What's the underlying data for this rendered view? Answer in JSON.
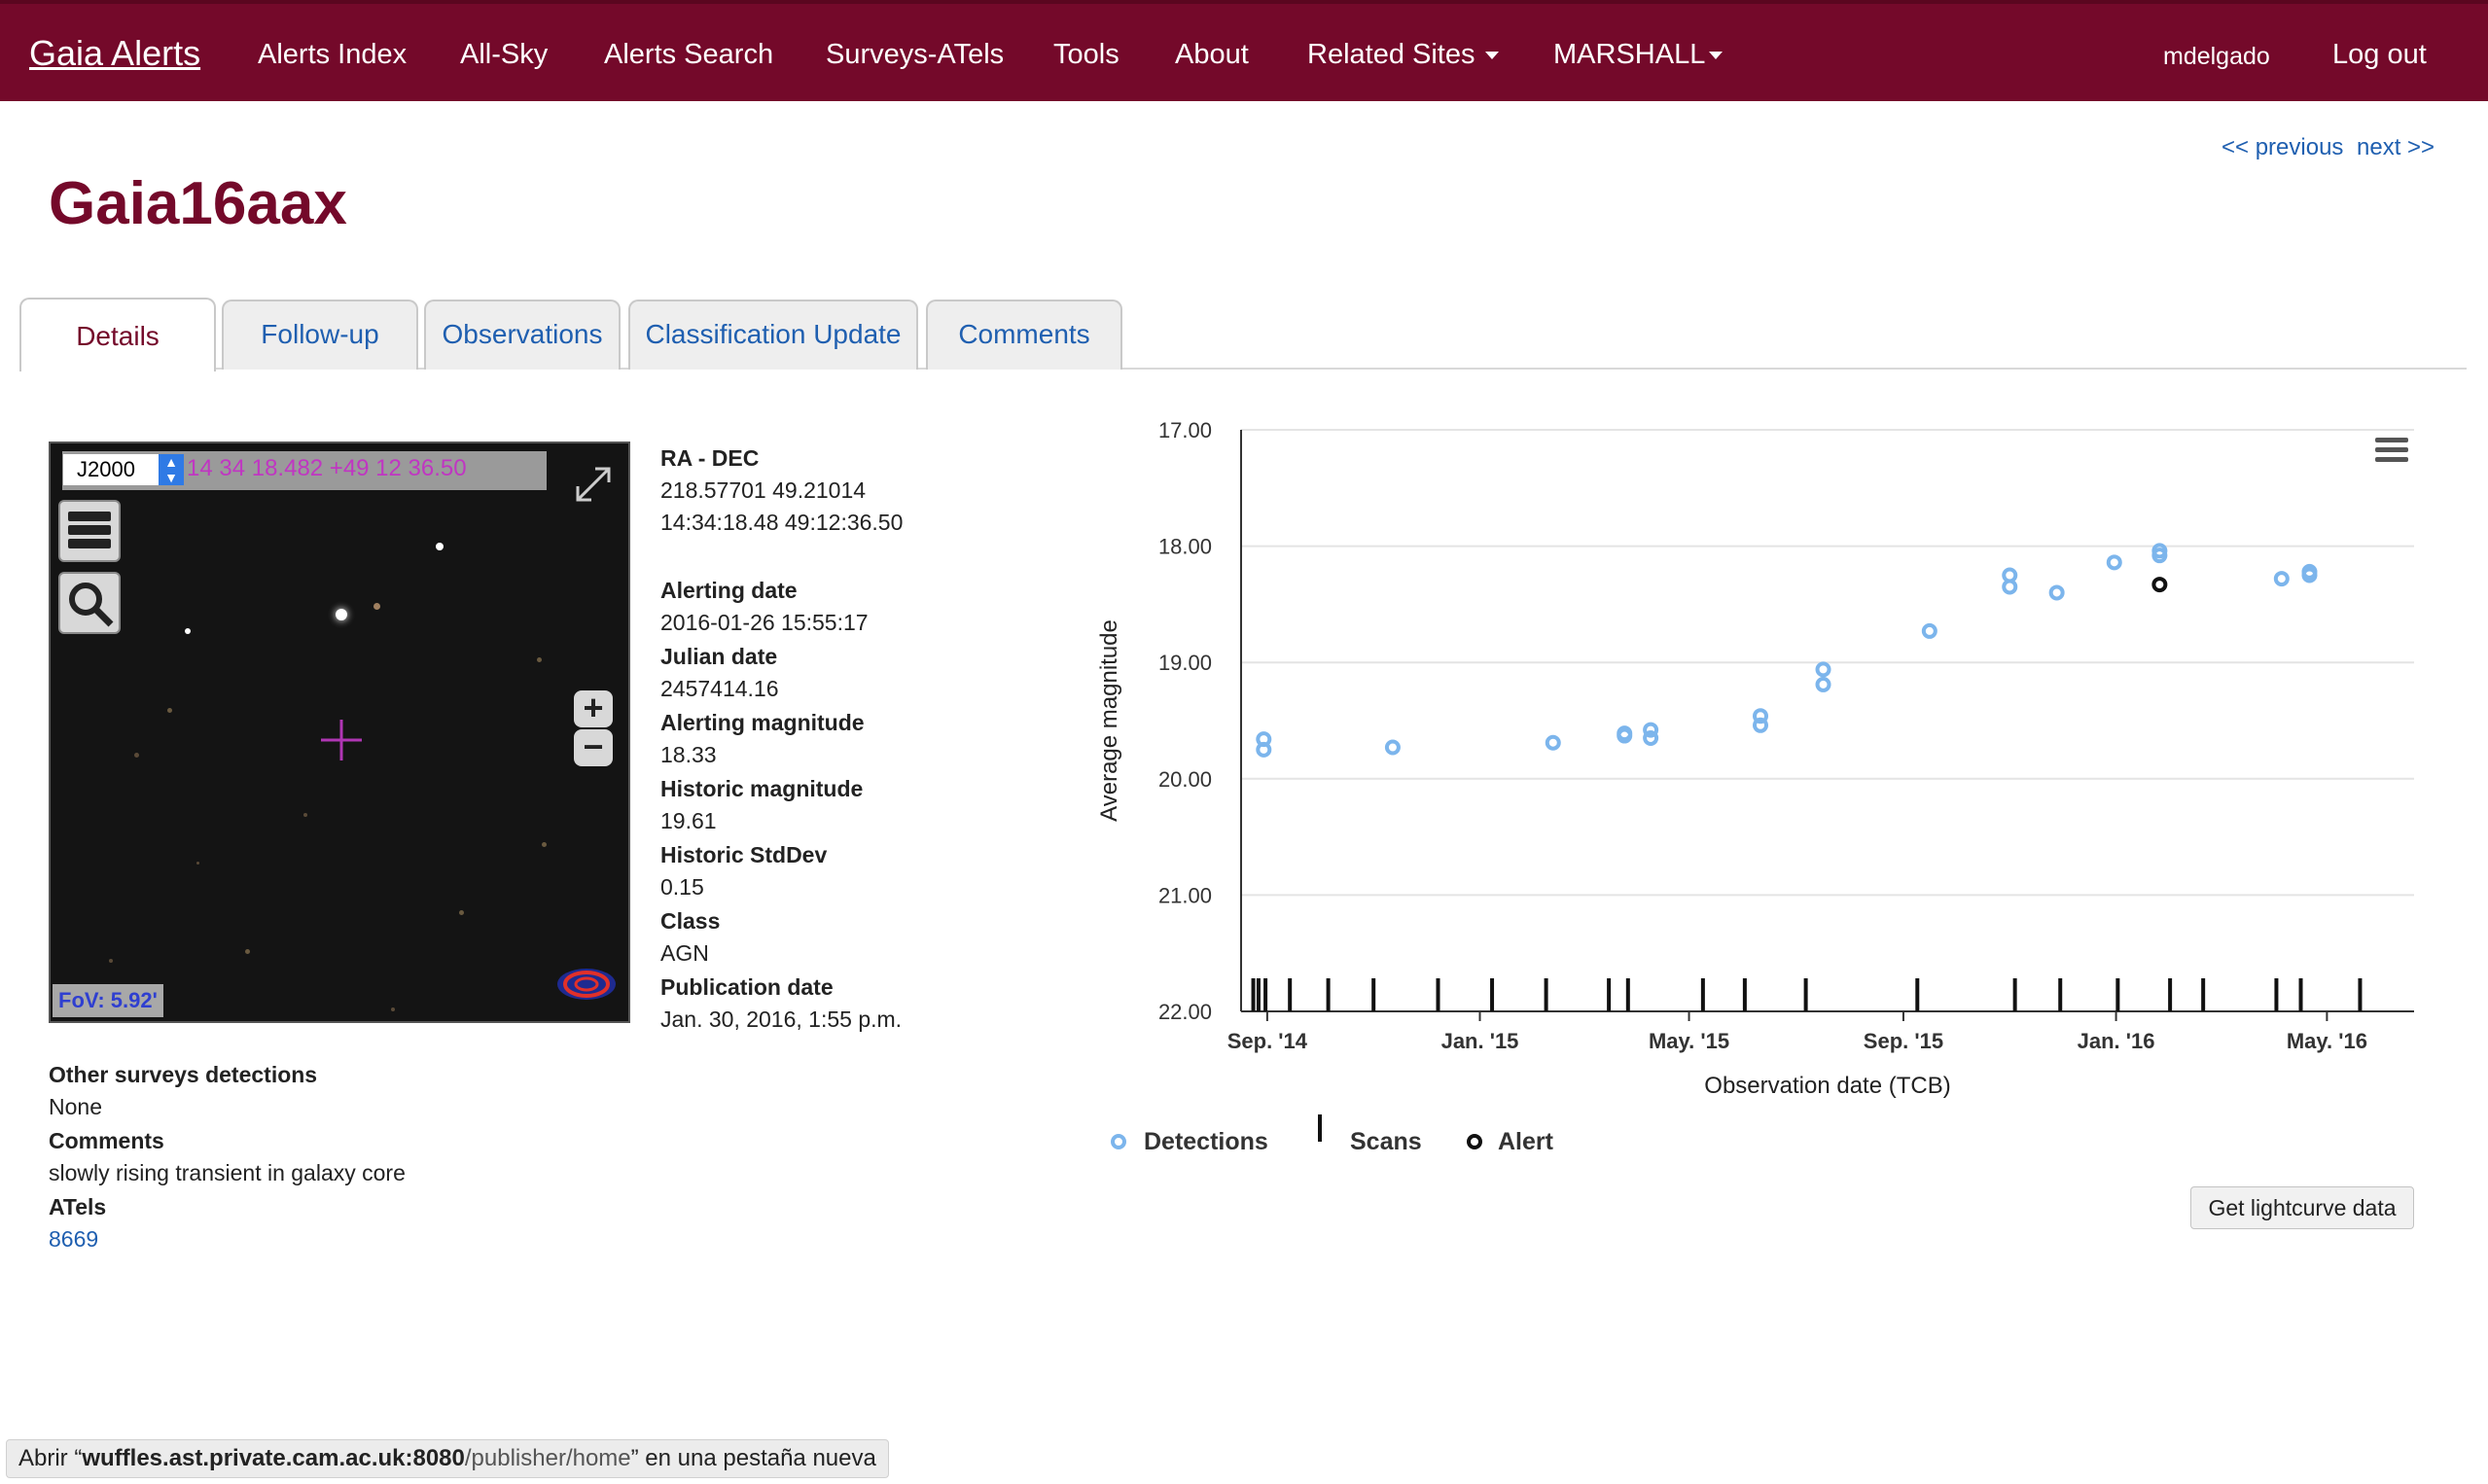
{
  "nav": {
    "brand": "Gaia Alerts",
    "items": [
      "Alerts Index",
      "All-Sky",
      "Alerts Search",
      "Surveys-ATels",
      "Tools",
      "About",
      "Related Sites",
      "MARSHALL"
    ],
    "user": "mdelgado",
    "logout": "Log out"
  },
  "pager": {
    "previous": "<< previous",
    "next": "next >>"
  },
  "page_title": "Gaia16aax",
  "tabs": [
    "Details",
    "Follow-up",
    "Observations",
    "Classification Update",
    "Comments"
  ],
  "sky": {
    "frame": "J2000",
    "coords": "14 34 18.482 +49 12 36.50",
    "fov": "FoV: 5.92'"
  },
  "details": {
    "ra_dec_label": "RA - DEC",
    "ra_dec_deg": "218.57701   49.21014",
    "ra_dec_sex": "14:34:18.48   49:12:36.50",
    "alerting_date_label": "Alerting date",
    "alerting_date": "2016-01-26 15:55:17",
    "julian_date_label": "Julian date",
    "julian_date": "2457414.16",
    "alerting_mag_label": "Alerting magnitude",
    "alerting_mag": "18.33",
    "historic_mag_label": "Historic magnitude",
    "historic_mag": "19.61",
    "historic_std_label": "Historic StdDev",
    "historic_std": "0.15",
    "class_label": "Class",
    "class": "AGN",
    "pub_date_label": "Publication date",
    "pub_date": "Jan. 30, 2016, 1:55 p.m."
  },
  "extra": {
    "other_surveys_label": "Other surveys detections",
    "other_surveys": "None",
    "comments_label": "Comments",
    "comments": "slowly rising transient in galaxy core",
    "atels_label": "ATels",
    "atel": "8669"
  },
  "chart_data": {
    "type": "scatter",
    "xlabel": "Observation date (TCB)",
    "ylabel": "Average magnitude",
    "x_ticks": [
      "Sep. '14",
      "Jan. '15",
      "May. '15",
      "Sep. '15",
      "Jan. '16",
      "May. '16"
    ],
    "y_ticks": [
      "17.00",
      "18.00",
      "19.00",
      "20.00",
      "21.00",
      "22.00"
    ],
    "ylim": [
      22.0,
      17.0
    ],
    "y_inverted": true,
    "grid": true,
    "legend_position": "bottom-left",
    "legend": [
      "Detections",
      "Scans",
      "Alert"
    ],
    "colors": {
      "detections": "#7cb5ec",
      "alert": "#111111",
      "scans": "#111111"
    },
    "series": [
      {
        "name": "Detections",
        "points": [
          {
            "x": "2014-08-30",
            "y": 19.66
          },
          {
            "x": "2014-08-30",
            "y": 19.75
          },
          {
            "x": "2014-11-12",
            "y": 19.73
          },
          {
            "x": "2015-02-12",
            "y": 19.69
          },
          {
            "x": "2015-03-25",
            "y": 19.63
          },
          {
            "x": "2015-03-25",
            "y": 19.61
          },
          {
            "x": "2015-04-09",
            "y": 19.65
          },
          {
            "x": "2015-04-09",
            "y": 19.58
          },
          {
            "x": "2015-06-11",
            "y": 19.46
          },
          {
            "x": "2015-06-11",
            "y": 19.54
          },
          {
            "x": "2015-07-17",
            "y": 19.06
          },
          {
            "x": "2015-07-17",
            "y": 19.19
          },
          {
            "x": "2015-09-16",
            "y": 18.73
          },
          {
            "x": "2015-11-01",
            "y": 18.25
          },
          {
            "x": "2015-11-01",
            "y": 18.35
          },
          {
            "x": "2015-11-28",
            "y": 18.4
          },
          {
            "x": "2015-12-31",
            "y": 18.14
          },
          {
            "x": "2016-01-26",
            "y": 18.04
          },
          {
            "x": "2016-01-26",
            "y": 18.08
          },
          {
            "x": "2016-04-05",
            "y": 18.28
          },
          {
            "x": "2016-04-21",
            "y": 18.22
          },
          {
            "x": "2016-04-21",
            "y": 18.25
          }
        ]
      },
      {
        "name": "Alert",
        "points": [
          {
            "x": "2016-01-26",
            "y": 18.33
          }
        ]
      },
      {
        "name": "Scans",
        "x": [
          "2014-08-24",
          "2014-08-27",
          "2014-08-31",
          "2014-09-14",
          "2014-10-06",
          "2014-11-01",
          "2014-12-08",
          "2015-01-08",
          "2015-02-08",
          "2015-03-16",
          "2015-03-27",
          "2015-05-09",
          "2015-06-02",
          "2015-07-07",
          "2015-09-09",
          "2015-11-04",
          "2015-11-30",
          "2016-01-02",
          "2016-02-01",
          "2016-02-20",
          "2016-04-02",
          "2016-04-16",
          "2016-05-20"
        ]
      }
    ],
    "button": "Get lightcurve data"
  },
  "status_bar": {
    "prefix": "Abrir “",
    "host": "wuffles.ast.private.cam.ac.uk:8080",
    "path": "/publisher/home",
    "suffix": "” en una pestaña nueva"
  }
}
